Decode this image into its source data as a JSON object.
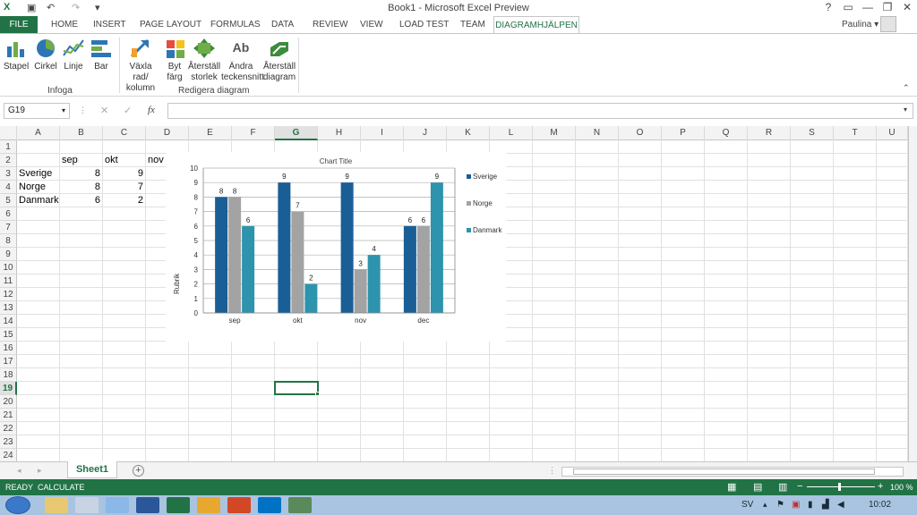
{
  "window": {
    "title": "Book1 - Microsoft Excel Preview",
    "help": "?",
    "minimize": "—",
    "restore": "❐",
    "close": "✕"
  },
  "user": {
    "name": "Paulina"
  },
  "tabs": {
    "file": "FILE",
    "home": "HOME",
    "insert": "INSERT",
    "page_layout": "PAGE LAYOUT",
    "formulas": "FORMULAS",
    "data": "DATA",
    "review": "REVIEW",
    "view": "VIEW",
    "load_test": "LOAD TEST",
    "team": "TEAM",
    "diagram": "DIAGRAMHJÄLPEN"
  },
  "ribbon": {
    "insert_group": {
      "label": "Infoga",
      "stapel": "Stapel",
      "cirkel": "Cirkel",
      "linje": "Linje",
      "bar": "Bar"
    },
    "edit_group": {
      "label": "Redigera diagram",
      "switch1": "Växla rad/",
      "switch2": "kolumn",
      "color1": "Byt",
      "color2": "färg",
      "resize1": "Återställ",
      "resize2": "storlek",
      "font1": "Ändra",
      "font2": "teckensnitt",
      "reset1": "Återställ",
      "reset2": "diagram"
    }
  },
  "formula_bar": {
    "name_box": "G19",
    "value": "",
    "fx": "fx"
  },
  "columns": [
    "A",
    "B",
    "C",
    "D",
    "E",
    "F",
    "G",
    "H",
    "I",
    "J",
    "K",
    "L",
    "M",
    "N",
    "O",
    "P",
    "Q",
    "R",
    "S",
    "T",
    "U"
  ],
  "rows": [
    "1",
    "2",
    "3",
    "4",
    "5",
    "6",
    "7",
    "8",
    "9",
    "10",
    "11",
    "12",
    "13",
    "14",
    "15",
    "16",
    "17",
    "18",
    "19",
    "20",
    "21",
    "22",
    "23",
    "24"
  ],
  "cells": {
    "B2": "sep",
    "C2": "okt",
    "D2": "nov",
    "A3": "Sverige",
    "B3": "8",
    "C3": "9",
    "A4": "Norge",
    "B4": "8",
    "C4": "7",
    "A5": "Danmark",
    "B5": "6",
    "C5": "2"
  },
  "chart_data": {
    "type": "bar",
    "title": "Chart Title",
    "xlabel": "",
    "ylabel": "Rubrik",
    "categories": [
      "sep",
      "okt",
      "nov",
      "dec"
    ],
    "series": [
      {
        "name": "Sverige",
        "values": [
          8,
          9,
          9,
          6
        ],
        "color": "#1a5e96"
      },
      {
        "name": "Norge",
        "values": [
          8,
          7,
          3,
          6
        ],
        "color": "#a3a3a3"
      },
      {
        "name": "Danmark",
        "values": [
          6,
          2,
          4,
          9
        ],
        "color": "#2e93ad"
      }
    ],
    "ylim": [
      0,
      10
    ],
    "yticks": [
      "0",
      "1",
      "2",
      "3",
      "4",
      "5",
      "6",
      "7",
      "8",
      "9",
      "10"
    ],
    "grid": true,
    "legend": "right"
  },
  "sheet": {
    "active": "Sheet1",
    "add": "+"
  },
  "status": {
    "ready": "READY",
    "calculate": "CALCULATE",
    "zoom": "100 %"
  },
  "taskbar": {
    "lang": "SV",
    "time": "10:02"
  },
  "colors": {
    "accent": "#217346"
  }
}
